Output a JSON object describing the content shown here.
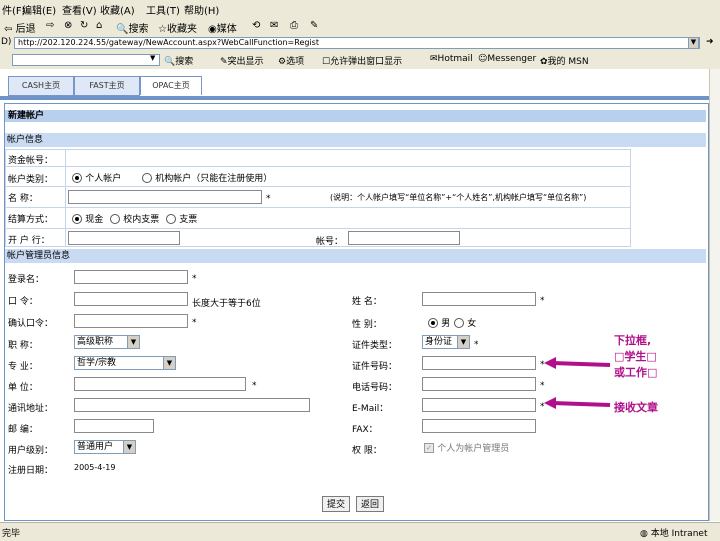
{
  "menu": {
    "items": [
      "件(F)",
      "编辑(E)",
      "查看(V)",
      "收藏(A)",
      "工具(T)",
      "帮助(H)"
    ]
  },
  "toolbar": {
    "back": "后退",
    "search": "搜索",
    "favorites": "收藏夹",
    "media": "媒体"
  },
  "address": {
    "label": "D)",
    "url": "http://202.120.224.55/gateway/NewAccount.aspx?WebCallFunction=Regist"
  },
  "links": {
    "search": "搜索",
    "popup": "突出显示",
    "options": "选项",
    "allow_popup": "允许弹出窗口显示",
    "hotmail": "Hotmail",
    "messenger": "Messenger",
    "msn": "我的 MSN"
  },
  "tabs": [
    "CASH主页",
    "FAST主页",
    "OPAC主页"
  ],
  "page_title": "新建帐户",
  "section_account": "帐户信息",
  "account": {
    "fund_no_label": "资金帐号：",
    "type_label": "帐户类别：",
    "type_options": [
      "个人帐户",
      "机构帐户（只能在注册使用）"
    ],
    "name_label": "名    称：",
    "name_note": "(说明：个人帐户填写“单位名称”+“个人姓名”,机构帐户填写“单位名称”)",
    "pay_label": "结算方式：",
    "pay_options": [
      "现金",
      "校内支票",
      "支票"
    ],
    "bank_label": "开 户 行：",
    "acct_no_label": "帐号："
  },
  "section_manager": "帐户管理员信息",
  "manager": {
    "login_label": "登录名：",
    "password_label": "口    令：",
    "password_hint": "长度大于等于6位",
    "confirm_label": "确认口令：",
    "title_label": "职    称：",
    "title_value": "高级职称",
    "major_label": "专    业：",
    "major_value": "哲学/宗教",
    "unit_label": "单    位：",
    "address_label": "通讯地址：",
    "zip_label": "邮    编：",
    "user_level_label": "用户级别：",
    "user_level_value": "普通用户",
    "regdate_label": "注册日期：",
    "regdate_value": "2005-4-19",
    "surname_label": "姓    名：",
    "gender_label": "性    别：",
    "gender_options": [
      "男",
      "女"
    ],
    "id_type_label": "证件类型：",
    "id_type_value": "身份证",
    "id_no_label": "证件号码：",
    "phone_label": "电话号码：",
    "email_label": "E-Mail：",
    "fax_label": "FAX：",
    "perm_label": "权    限：",
    "perm_value": "个人为帐户管理员"
  },
  "buttons": {
    "submit": "提交",
    "back": "返回"
  },
  "annotations": {
    "select_note": [
      "下拉框,",
      "□学生□",
      "或工作□"
    ],
    "fill_note": "接收文章"
  },
  "status": {
    "left": "完毕",
    "right": "本地 Intranet"
  }
}
